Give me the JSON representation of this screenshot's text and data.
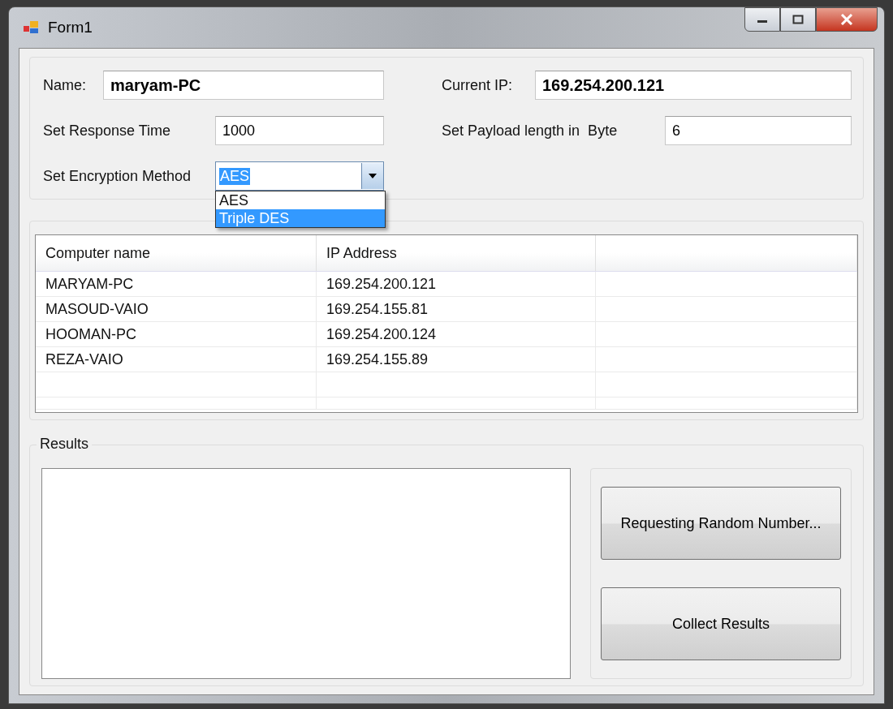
{
  "window": {
    "title": "Form1"
  },
  "settings": {
    "name": {
      "label": "Name:",
      "value": "maryam-PC"
    },
    "current_ip": {
      "label": "Current IP:",
      "value": "169.254.200.121"
    },
    "response_time": {
      "label": "Set Response Time",
      "value": "1000"
    },
    "payload_length": {
      "label": "Set Payload length in  Byte",
      "value": "6"
    },
    "encryption": {
      "label": "Set Encryption Method",
      "value": "AES",
      "expanded": true,
      "options": [
        {
          "label": "AES",
          "highlighted": false
        },
        {
          "label": "Triple DES",
          "highlighted": true
        }
      ]
    }
  },
  "table": {
    "columns": [
      "Computer name",
      "IP Address"
    ],
    "rows": [
      {
        "computer_name": "MARYAM-PC",
        "ip_address": "169.254.200.121"
      },
      {
        "computer_name": "MASOUD-VAIO",
        "ip_address": "169.254.155.81"
      },
      {
        "computer_name": "HOOMAN-PC",
        "ip_address": "169.254.200.124"
      },
      {
        "computer_name": "REZA-VAIO",
        "ip_address": "169.254.155.89"
      }
    ]
  },
  "results": {
    "title": "Results",
    "buttons": [
      "Requesting Random Number...",
      "Collect Results"
    ]
  }
}
